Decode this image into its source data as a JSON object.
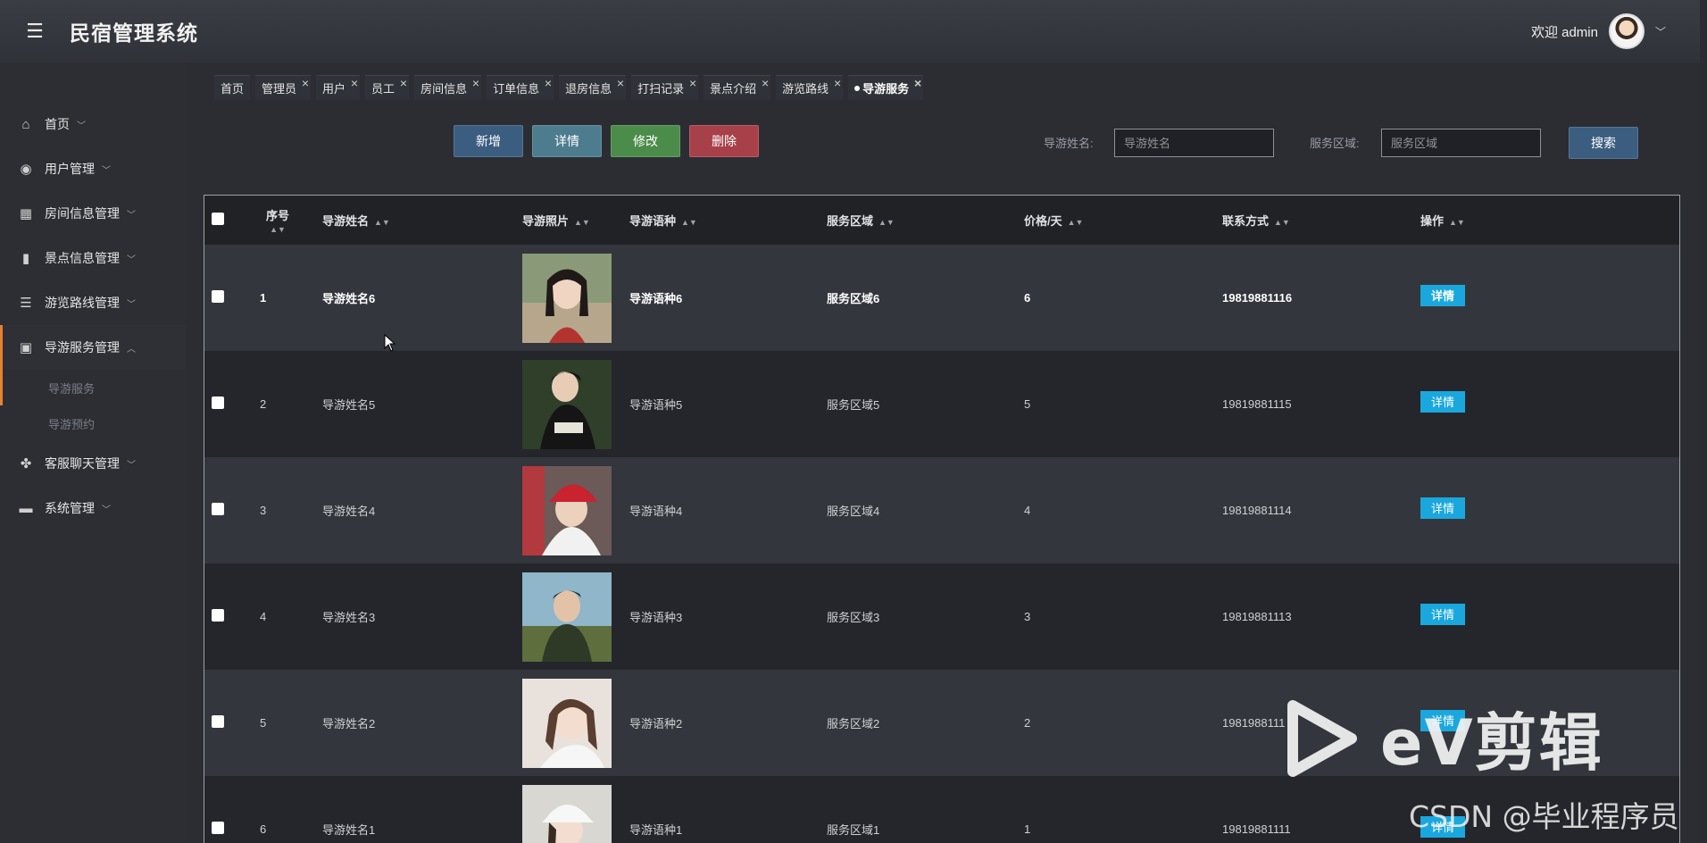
{
  "header": {
    "menu_icon": "hamburger-icon",
    "title": "民宿管理系统",
    "welcome": "欢迎 admin"
  },
  "sidebar": {
    "items": [
      {
        "label": "首页",
        "icon": "home-icon"
      },
      {
        "label": "用户管理",
        "icon": "compass-icon"
      },
      {
        "label": "房间信息管理",
        "icon": "store-icon"
      },
      {
        "label": "景点信息管理",
        "icon": "bookmark-icon"
      },
      {
        "label": "游览路线管理",
        "icon": "list-icon"
      },
      {
        "label": "导游服务管理",
        "icon": "chart-icon"
      },
      {
        "label": "客服聊天管理",
        "icon": "grid-icon"
      },
      {
        "label": "系统管理",
        "icon": "wallet-icon"
      }
    ],
    "submenu": [
      "导游服务",
      "导游预约"
    ]
  },
  "tabs": [
    "首页",
    "管理员",
    "用户",
    "员工",
    "房间信息",
    "订单信息",
    "退房信息",
    "打扫记录",
    "景点介绍",
    "游览路线",
    "导游服务"
  ],
  "toolbar": {
    "add": "新增",
    "detail": "详情",
    "edit": "修改",
    "delete": "删除",
    "search_button": "搜索"
  },
  "search": {
    "name_label": "导游姓名:",
    "name_placeholder": "导游姓名",
    "area_label": "服务区域:",
    "area_placeholder": "服务区域"
  },
  "table": {
    "headers": [
      "序号",
      "导游姓名",
      "导游照片",
      "导游语种",
      "服务区域",
      "价格/天",
      "联系方式",
      "操作"
    ],
    "row_action": "详情",
    "rows": [
      {
        "index": "1",
        "name": "导游姓名6",
        "language": "导游语种6",
        "area": "服务区域6",
        "price": "6",
        "phone": "19819881116"
      },
      {
        "index": "2",
        "name": "导游姓名5",
        "language": "导游语种5",
        "area": "服务区域5",
        "price": "5",
        "phone": "19819881115"
      },
      {
        "index": "3",
        "name": "导游姓名4",
        "language": "导游语种4",
        "area": "服务区域4",
        "price": "4",
        "phone": "19819881114"
      },
      {
        "index": "4",
        "name": "导游姓名3",
        "language": "导游语种3",
        "area": "服务区域3",
        "price": "3",
        "phone": "19819881113"
      },
      {
        "index": "5",
        "name": "导游姓名2",
        "language": "导游语种2",
        "area": "服务区域2",
        "price": "2",
        "phone": "1981988111"
      },
      {
        "index": "6",
        "name": "导游姓名1",
        "language": "导游语种1",
        "area": "服务区域1",
        "price": "1",
        "phone": "19819881111"
      }
    ]
  },
  "watermark": {
    "ev": "eV剪辑",
    "csdn": "CSDN @毕业程序员"
  },
  "colors": {
    "accent_orange": "#e7812e",
    "btn_add": "#3b5d80",
    "btn_detail": "#4d7c8f",
    "btn_edit": "#4c8c4a",
    "btn_delete": "#a8404a",
    "row_detail": "#1aa7de"
  }
}
